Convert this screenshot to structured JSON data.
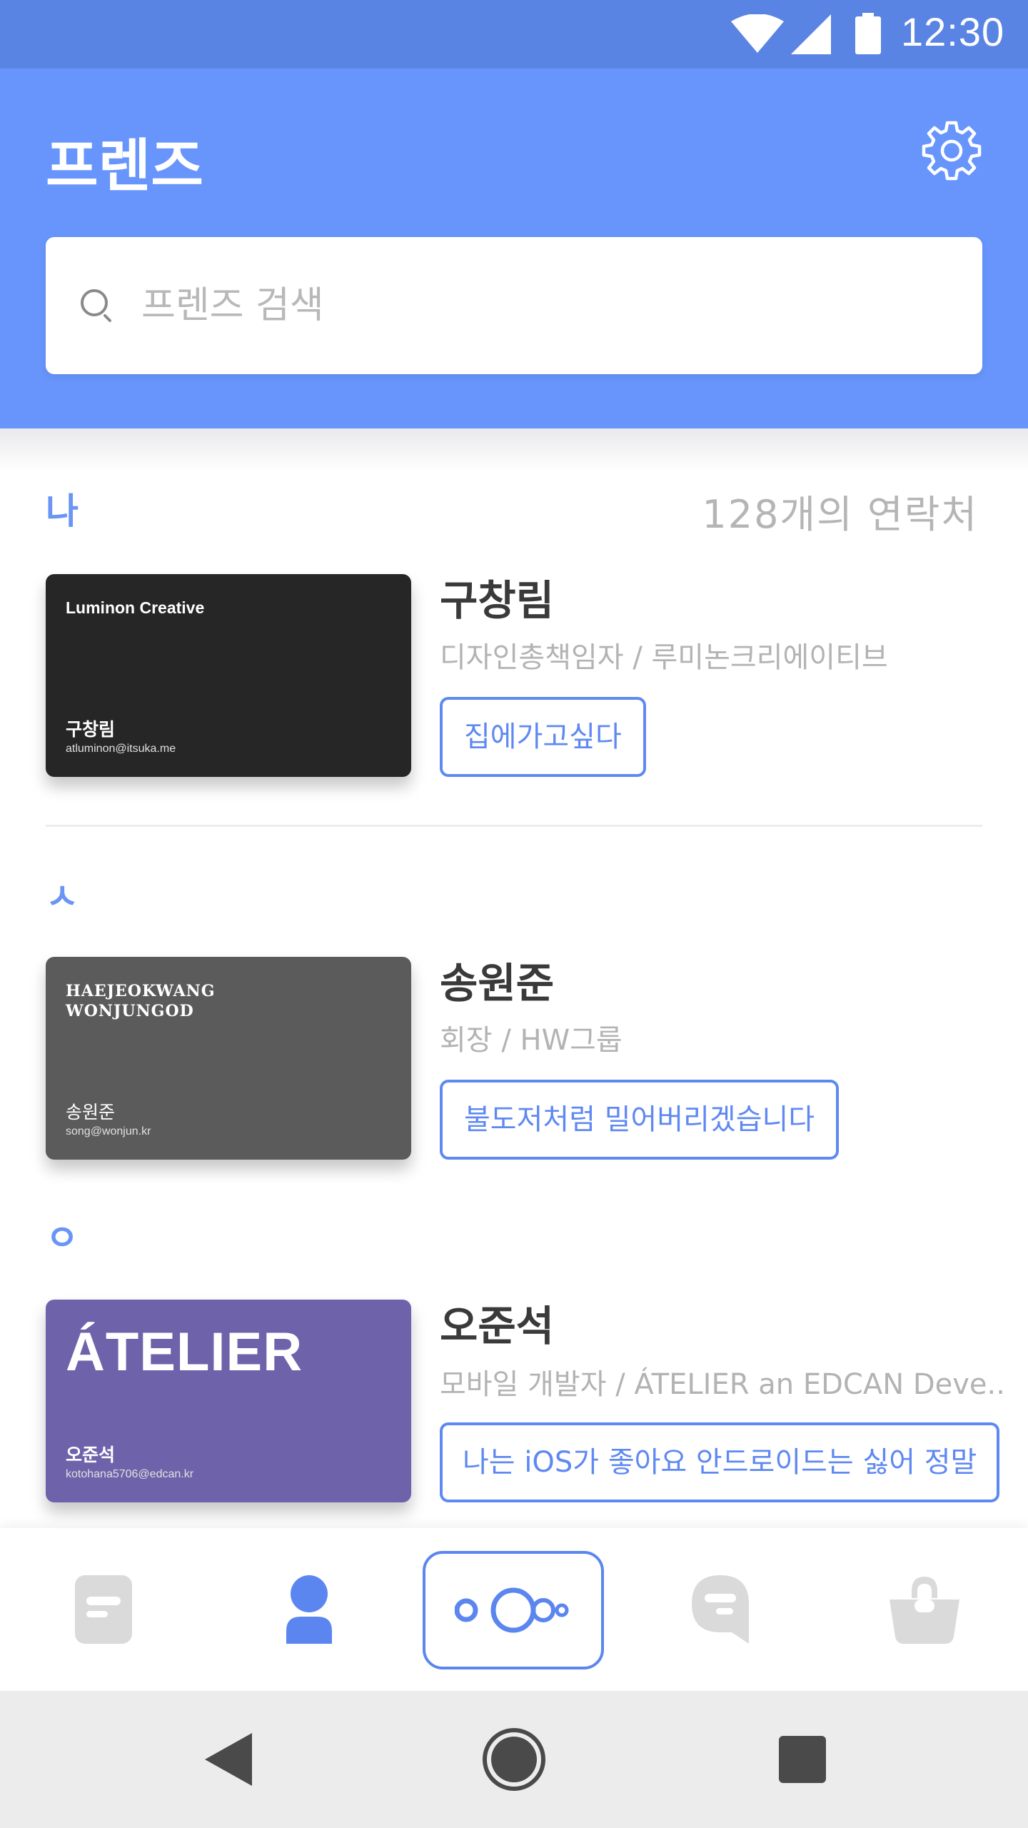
{
  "status_bar": {
    "time": "12:30"
  },
  "header": {
    "title": "프렌즈",
    "search_placeholder": "프렌즈 검색"
  },
  "colors": {
    "primary": "#6895fc",
    "status_bar": "#5a84e3",
    "accent_text": "#5f89f2"
  },
  "sections": [
    {
      "label": "나",
      "count_label": "128개의 연락처"
    },
    {
      "label": "ㅅ"
    },
    {
      "label": "ㅇ"
    }
  ],
  "contacts": [
    {
      "name": "구창림",
      "role": "디자인총책임자 / 루미논크리에이티브",
      "status": "집에가고싶다",
      "card": {
        "company": "Luminon Creative",
        "name": "구창림",
        "email": "atluminon@itsuka.me",
        "color": "#262626"
      }
    },
    {
      "name": "송원준",
      "role": "회장 / HW그룹",
      "status": "불도저처럼 밀어버리겠습니다",
      "card": {
        "company_line1": "HAEJEOKWANG",
        "company_line2": "WONJUNGOD",
        "name": "송원준",
        "email": "song@wonjun.kr",
        "color": "#5b5b5b"
      }
    },
    {
      "name": "오준석",
      "role": "모바일 개발자 / ÁTELIER an EDCAN Deve..",
      "status": "나는 iOS가 좋아요 안드로이드는 싫어 정말",
      "card": {
        "company": "ÁTELIER",
        "name": "오준석",
        "email": "kotohana5706@edcan.kr",
        "color": "#6e63aa"
      }
    }
  ],
  "bottom_nav": {
    "items": [
      "document-icon",
      "person-icon",
      "circles-icon",
      "chat-icon",
      "bag-icon"
    ],
    "active": "person-icon"
  },
  "system_nav": [
    "back-icon",
    "home-icon",
    "recents-icon"
  ]
}
